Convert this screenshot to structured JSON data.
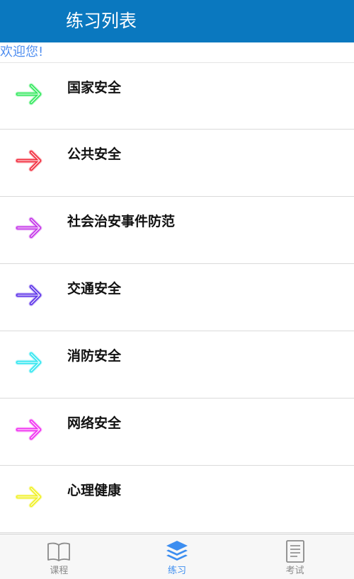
{
  "header": {
    "title": "练习列表"
  },
  "welcome": "欢迎您!",
  "practice_list": [
    {
      "label": "国家安全",
      "icon": "arrow-right-icon",
      "color": "#2ee85a"
    },
    {
      "label": "公共安全",
      "icon": "arrow-right-icon",
      "color": "#f2293a"
    },
    {
      "label": "社会治安事件防范",
      "icon": "arrow-right-icon",
      "color": "#c432e8"
    },
    {
      "label": "交通安全",
      "icon": "arrow-right-icon",
      "color": "#5a2fe8"
    },
    {
      "label": "消防安全",
      "icon": "arrow-right-icon",
      "color": "#2fe6f0"
    },
    {
      "label": "网络安全",
      "icon": "arrow-right-icon",
      "color": "#f02cf0"
    },
    {
      "label": "心理健康",
      "icon": "arrow-right-icon",
      "color": "#f0f020"
    }
  ],
  "tabbar": {
    "tabs": [
      {
        "label": "课程",
        "icon": "book-icon",
        "active": false
      },
      {
        "label": "练习",
        "icon": "layers-icon",
        "active": true
      },
      {
        "label": "考试",
        "icon": "document-icon",
        "active": false
      }
    ],
    "active_color": "#3d8ef0",
    "inactive_color": "#8a8a8a"
  }
}
